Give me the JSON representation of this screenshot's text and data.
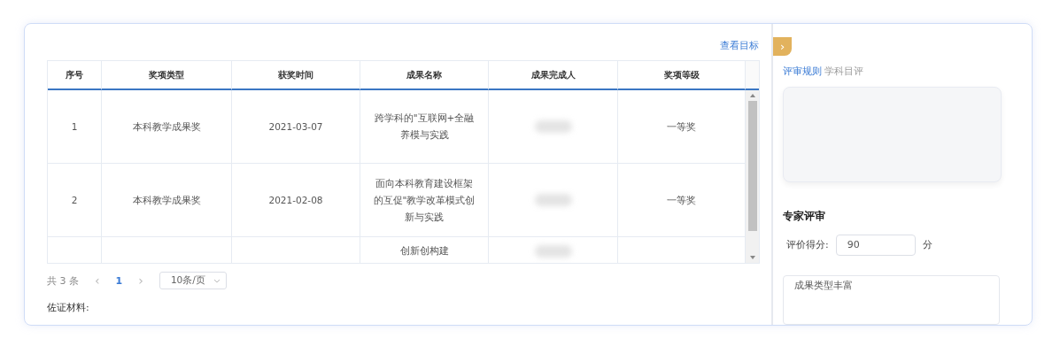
{
  "view_target_link": "查看目标",
  "table": {
    "columns": [
      "序号",
      "奖项类型",
      "获奖时间",
      "成果名称",
      "成果完成人",
      "奖项等级"
    ],
    "rows": [
      {
        "index": "1",
        "award_type": "本科教学成果奖",
        "date": "2021-03-07",
        "name": "跨学科的\"互联网+全融养模与实践",
        "level_name": "一等奖"
      },
      {
        "index": "2",
        "award_type": "本科教学成果奖",
        "date": "2021-02-08",
        "name": "面向本科教育建设框架的互促\"教学改革模式创新与实践",
        "level_name": "一等奖"
      },
      {
        "name": "创新创构建"
      }
    ]
  },
  "pagination": {
    "total": "共 3 条",
    "prev": "‹",
    "pages": [
      {
        "label": "1",
        "selected": true
      }
    ],
    "next": "›",
    "page_size": "10条/页"
  },
  "evidence_label": "佐证材料:",
  "panel": {
    "toggle": "›",
    "tabs": [
      {
        "label": "评审规则",
        "selected": true
      },
      {
        "label": "学科目评",
        "selected": false
      }
    ],
    "section_title": "专家评审",
    "score_label": "评价得分:",
    "score": "90",
    "score_unit": "分",
    "comment": "成果类型丰富"
  }
}
